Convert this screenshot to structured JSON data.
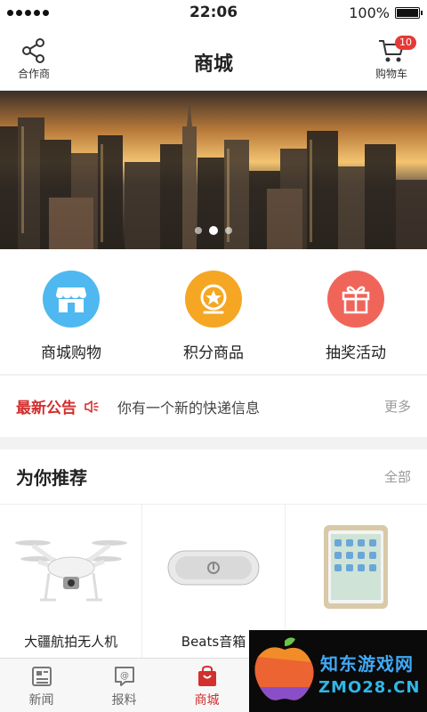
{
  "status_bar": {
    "time": "22:06",
    "battery": "100%"
  },
  "header": {
    "title": "商城",
    "left_label": "合作商",
    "right_label": "购物车",
    "cart_count": "10"
  },
  "banner": {
    "slide_count": 3,
    "active_index": 1
  },
  "categories": [
    {
      "label": "商城购物",
      "icon": "store-icon",
      "color": "#4fb8f0"
    },
    {
      "label": "积分商品",
      "icon": "medal-icon",
      "color": "#f5a623"
    },
    {
      "label": "抽奖活动",
      "icon": "gift-icon",
      "color": "#f0655a"
    }
  ],
  "notice": {
    "title": "最新公告",
    "text": "你有一个新的快递信息",
    "more": "更多"
  },
  "recommend": {
    "title": "为你推荐",
    "all": "全部",
    "products": [
      {
        "name": "大疆航拍无人机",
        "icon": "drone-icon"
      },
      {
        "name": "Beats音箱",
        "icon": "speaker-icon"
      },
      {
        "name": "",
        "icon": "tablet-icon"
      }
    ]
  },
  "tabbar": {
    "items": [
      {
        "label": "新闻",
        "icon": "news-icon"
      },
      {
        "label": "报料",
        "icon": "report-icon"
      },
      {
        "label": "商城",
        "icon": "shop-bag-icon",
        "active": true
      }
    ]
  },
  "watermark": {
    "line1": "知东游戏网",
    "line2": "ZMO28.CN"
  },
  "colors": {
    "accent": "#d32f2f",
    "blue": "#4fb8f0",
    "orange": "#f5a623",
    "coral": "#f0655a"
  }
}
